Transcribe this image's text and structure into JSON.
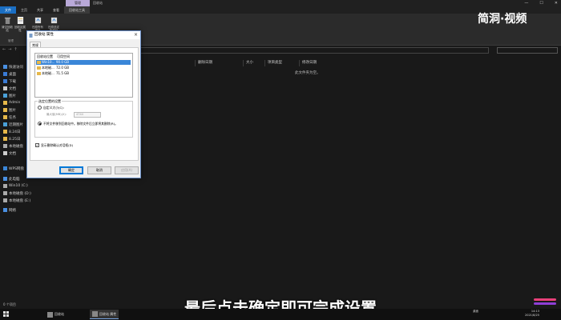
{
  "window": {
    "manage_tab": "管理",
    "title": "回收站",
    "controls": [
      "—",
      "☐",
      "✕"
    ]
  },
  "ribbon": {
    "tabs": [
      "文件",
      "主页",
      "共享",
      "查看",
      "回收站工具"
    ],
    "buttons": [
      {
        "label": "清空回收站",
        "icon": "empty-bin-icon"
      },
      {
        "label": "回收站属性",
        "icon": "bin-properties-icon"
      },
      {
        "label": "还原所有项目",
        "icon": "restore-all-icon"
      },
      {
        "label": "还原选定的项目",
        "icon": "restore-selected-icon"
      }
    ],
    "groups": [
      "管理",
      "还原"
    ]
  },
  "search": {
    "placeholder": ""
  },
  "sidebar": {
    "items": [
      "快速访问",
      "桌面",
      "下载",
      "文档",
      "图片",
      "Admin",
      "图片",
      "任务",
      "近期图片",
      "8.24日",
      "8.25日",
      "本地磁盘",
      "文档",
      "WPS网盘",
      "此电脑",
      "Win10 (C:)",
      "本地磁盘 (D:)",
      "本地磁盘 (E:)",
      "网络"
    ]
  },
  "filelist": {
    "columns": [
      "删除日期",
      "大小",
      "项目类型",
      "修改日期"
    ],
    "empty_message": "此文件夹为空。"
  },
  "status": {
    "count": "0 个项目"
  },
  "dialog": {
    "title": "回收站 属性",
    "tab": "常规",
    "vol_headers": [
      "回收站位置",
      "可用空间"
    ],
    "volumes": [
      {
        "name": "Win10...",
        "size": "90.0 GB"
      },
      {
        "name": "本地磁...",
        "size": "72.0 GB"
      },
      {
        "name": "本地磁...",
        "size": "71.5 GB"
      }
    ],
    "settings_legend": "选定位置的设置",
    "custom_size_label": "自定义大小(C):",
    "max_size_label": "最大值(MB)(X):",
    "max_size_value": "4744",
    "no_move_label": "不将文件移到回收站中。移除文件后立即将其删除(R)。",
    "show_confirm_label": "显示删除确认对话框(D)",
    "buttons": [
      "确定",
      "取消",
      "应用(A)"
    ]
  },
  "overlay": {
    "logo": "简洞·视频",
    "subtitle": "最后点击确定即可完成设置"
  },
  "taskbar": {
    "items": [
      "回收站",
      "回收站 属性"
    ],
    "tray_text": "桌面",
    "time": "14:13",
    "date": "2021/8/25"
  }
}
